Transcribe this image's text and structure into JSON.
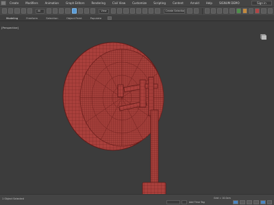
{
  "menubar": {
    "items": [
      "Create",
      "Modifiers",
      "Animation",
      "Graph Editors",
      "Rendering",
      "Civil View",
      "Customize",
      "Scripting",
      "Content",
      "Arnold",
      "Help",
      "SIGNUM DEMO"
    ],
    "signin_label": "Sign in"
  },
  "toolbar": {
    "filter_value": "All",
    "view_value": "View",
    "selection_set_placeholder": "Create Selection Se"
  },
  "ribbon": {
    "tabs": [
      "Modeling",
      "Freeform",
      "Selection",
      "Object Paint",
      "Populate"
    ]
  },
  "viewport": {
    "label": "[Perspective]"
  },
  "statusbar": {
    "selection_info": "1 Object Selected",
    "grid_info": "Grid = 10.0cm",
    "add_time_tag": "Add Time Tag",
    "autokey_label": "Auto Key",
    "setkey_label": "Set Key"
  },
  "colors": {
    "mesh_fill": "#a9403c",
    "mesh_wire": "#6e1f1d",
    "viewport_bg": "#3c3c3c",
    "active_tool": "#5a9bd6"
  }
}
